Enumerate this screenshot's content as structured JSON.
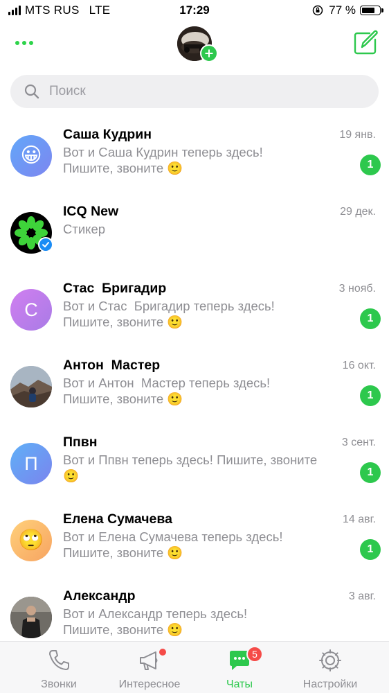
{
  "status_bar": {
    "carrier": "MTS RUS",
    "network": "LTE",
    "time": "17:29",
    "battery": "77 %",
    "battery_level": 0.77
  },
  "header": {
    "more_icon": "more-dots-icon",
    "compose_icon": "compose-icon"
  },
  "search": {
    "placeholder": "Поиск"
  },
  "colors": {
    "accent": "#2dc84d",
    "badge_red": "#f54b48",
    "verified_blue": "#1b8cf5",
    "secondary_text": "#8e8e93"
  },
  "chats": [
    {
      "name": "Саша Кудрин",
      "date": "19 янв.",
      "preview": "Вот и Саша Кудрин теперь здесь!\nПишите, звоните 🙂",
      "unread": "1",
      "avatar_emoji": "😀"
    },
    {
      "name": "ICQ New",
      "date": "29 дек.",
      "preview": "Стикер",
      "avatar_icon": "icq-flower-icon"
    },
    {
      "name": "Стас  Бригадир",
      "date": "3 нояб.",
      "preview": "Вот и Стас  Бригадир теперь здесь!\nПишите, звоните 🙂",
      "unread": "1",
      "avatar_letter": "С"
    },
    {
      "name": "Антон  Мастер",
      "date": "16 окт.",
      "preview": "Вот и Антон  Мастер теперь здесь!\nПишите, звоните 🙂",
      "unread": "1"
    },
    {
      "name": "Ппвн",
      "date": "3 сент.",
      "preview": "Вот и Ппвн теперь здесь! Пишите, звоните\n🙂",
      "unread": "1",
      "avatar_letter": "П"
    },
    {
      "name": "Елена Сумачева",
      "date": "14 авг.",
      "preview": "Вот и Елена Сумачева теперь здесь!\nПишите, звоните 🙂",
      "unread": "1",
      "avatar_emoji": "🙄"
    },
    {
      "name": "Александр",
      "date": "3 авг.",
      "preview": "Вот и Александр теперь здесь!\nПишите, звоните 🙂"
    }
  ],
  "tabs": [
    {
      "label": "Звонки",
      "icon": "phone-icon"
    },
    {
      "label": "Интересное",
      "icon": "megaphone-icon"
    },
    {
      "label": "Чаты",
      "icon": "chat-icon",
      "badge": "5"
    },
    {
      "label": "Настройки",
      "icon": "gear-icon"
    }
  ]
}
